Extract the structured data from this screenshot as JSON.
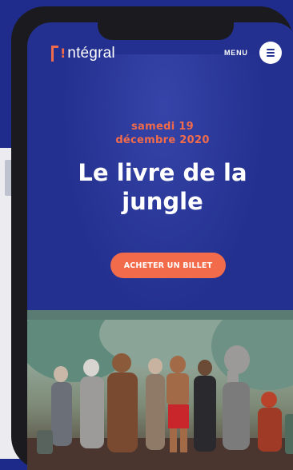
{
  "header": {
    "logo_mark": "!",
    "logo_text": "ntégral",
    "menu_label": "MENU",
    "menu_icon": "hamburger-icon"
  },
  "event": {
    "date_line1": "samedi 19",
    "date_line2": "décembre 2020",
    "title_line1": "Le livre de la",
    "title_line2": "jungle",
    "buy_button_label": "ACHETER UN BILLET"
  },
  "colors": {
    "brand_blue": "#23308f",
    "accent_orange": "#f26b4a",
    "white": "#ffffff"
  }
}
